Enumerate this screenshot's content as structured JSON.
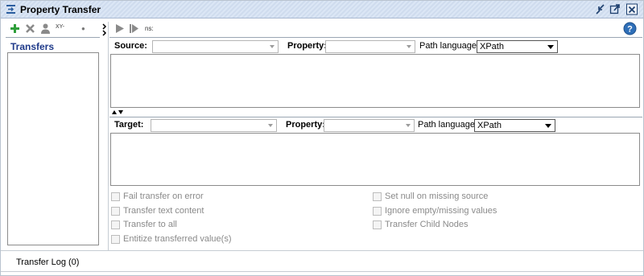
{
  "window": {
    "title": "Property Transfer",
    "title_icon": "property-transfer-icon",
    "controls": [
      "minimize-icon",
      "maximize-icon",
      "close-icon"
    ]
  },
  "left_toolbar": {
    "buttons": [
      "add-icon",
      "delete-icon",
      "user-icon"
    ],
    "xy_label": "XY-",
    "dot": "●"
  },
  "left_panel": {
    "transfers_label": "Transfers",
    "transfers": []
  },
  "right_toolbar": {
    "buttons": [
      "run-icon",
      "run-all-icon"
    ],
    "ns_label": "ns:",
    "help_icon": "help-icon"
  },
  "source": {
    "label": "Source:",
    "value": "",
    "property_label": "Property:",
    "property_value": "",
    "path_language_label": "Path language:",
    "path_language": "XPath",
    "expression": ""
  },
  "target": {
    "label": "Target:",
    "value": "",
    "property_label": "Property:",
    "property_value": "",
    "path_language_label": "Path language:",
    "path_language": "XPath",
    "expression": ""
  },
  "options": {
    "left": [
      {
        "label": "Fail transfer on error",
        "checked": false
      },
      {
        "label": "Transfer text content",
        "checked": false
      },
      {
        "label": "Transfer to all",
        "checked": false
      },
      {
        "label": "Entitize transferred value(s)",
        "checked": false
      }
    ],
    "right": [
      {
        "label": "Set null on missing source",
        "checked": false
      },
      {
        "label": "Ignore empty/missing values",
        "checked": false
      },
      {
        "label": "Transfer Child Nodes",
        "checked": false
      }
    ]
  },
  "bottom": {
    "log_tab": "Transfer Log (0)"
  },
  "colors": {
    "title_stripe": "#dbe6f5",
    "transfers_label": "#1f3a8a",
    "add_icon": "#2e9e3a",
    "help_icon": "#2f6fb8",
    "disabled_text": "#8a8a8a"
  }
}
